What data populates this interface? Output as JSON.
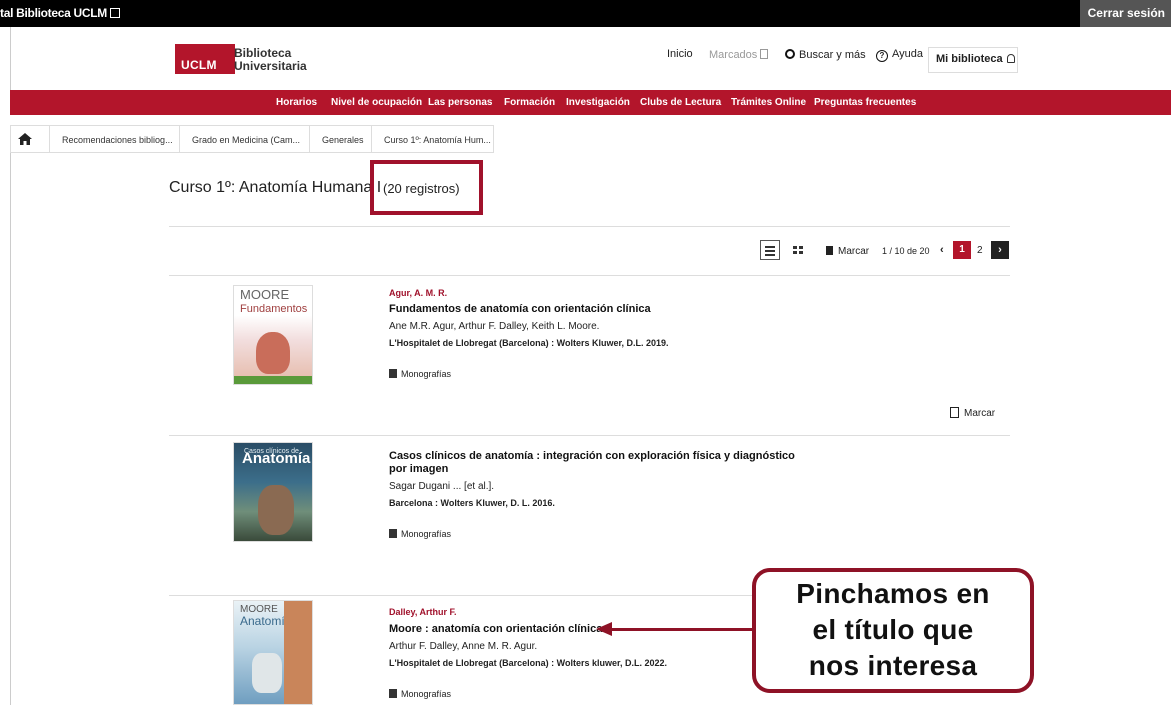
{
  "topbar": {
    "portal_label": "tal Biblioteca UCLM",
    "logout_label": "Cerrar sesión"
  },
  "header": {
    "logo_text": "UCLM",
    "brand_line1": "Biblioteca",
    "brand_line2": "Universitaria",
    "nav": {
      "inicio": "Inicio",
      "marcados": "Marcados",
      "buscar": "Buscar y más",
      "ayuda": "Ayuda",
      "mi_biblioteca": "Mi biblioteca"
    }
  },
  "red_nav": [
    "Horarios",
    "Nivel de ocupación",
    "Las personas",
    "Formación",
    "Investigación",
    "Clubs de Lectura",
    "Trámites Online",
    "Preguntas frecuentes"
  ],
  "breadcrumbs": [
    "Recomendaciones bibliog...",
    "Grado en Medicina (Cam...",
    "Generales",
    "Curso 1º: Anatomía Hum..."
  ],
  "page": {
    "title": "Curso 1º: Anatomía Humana I",
    "count": "(20 registros)"
  },
  "toolbar": {
    "marcar": "Marcar",
    "pager_count": "1 / 10 de 20",
    "prev": "‹",
    "page1": "1",
    "page2": "2",
    "next": "›"
  },
  "records": [
    {
      "cover_title": "MOORE",
      "cover_sub": "Fundamentos",
      "author": "Agur, A. M. R.",
      "title": "Fundamentos de anatomía con orientación clínica",
      "responsibility": "Ane M.R. Agur, Arthur F. Dalley, Keith L. Moore.",
      "publication": "L'Hospitalet de Llobregat (Barcelona) : Wolters Kluwer, D.L. 2019.",
      "type": "Monografías",
      "marcar": "Marcar"
    },
    {
      "cover_title": "Casos clínicos de",
      "cover_sub": "Anatomía",
      "author": "",
      "title": "Casos clínicos de anatomía : integración con exploración física y diagnóstico por imagen",
      "responsibility": "Sagar Dugani ... [et al.].",
      "publication": "Barcelona : Wolters Kluwer, D. L. 2016.",
      "type": "Monografías"
    },
    {
      "cover_title": "MOORE",
      "cover_sub": "Anatomía",
      "author": "Dalley, Arthur F.",
      "title": "Moore : anatomía con orientación clínica",
      "responsibility": "Arthur F. Dalley, Anne M. R. Agur.",
      "publication": "L'Hospitalet de Llobregat (Barcelona) : Wolters kluwer, D.L. 2022.",
      "type": "Monografías"
    }
  ],
  "callout": {
    "line1": "Pinchamos en",
    "line2": "el título que",
    "line3": "nos interesa"
  },
  "colors": {
    "brand_red": "#b3152b",
    "annotation_red": "#8e1226"
  }
}
